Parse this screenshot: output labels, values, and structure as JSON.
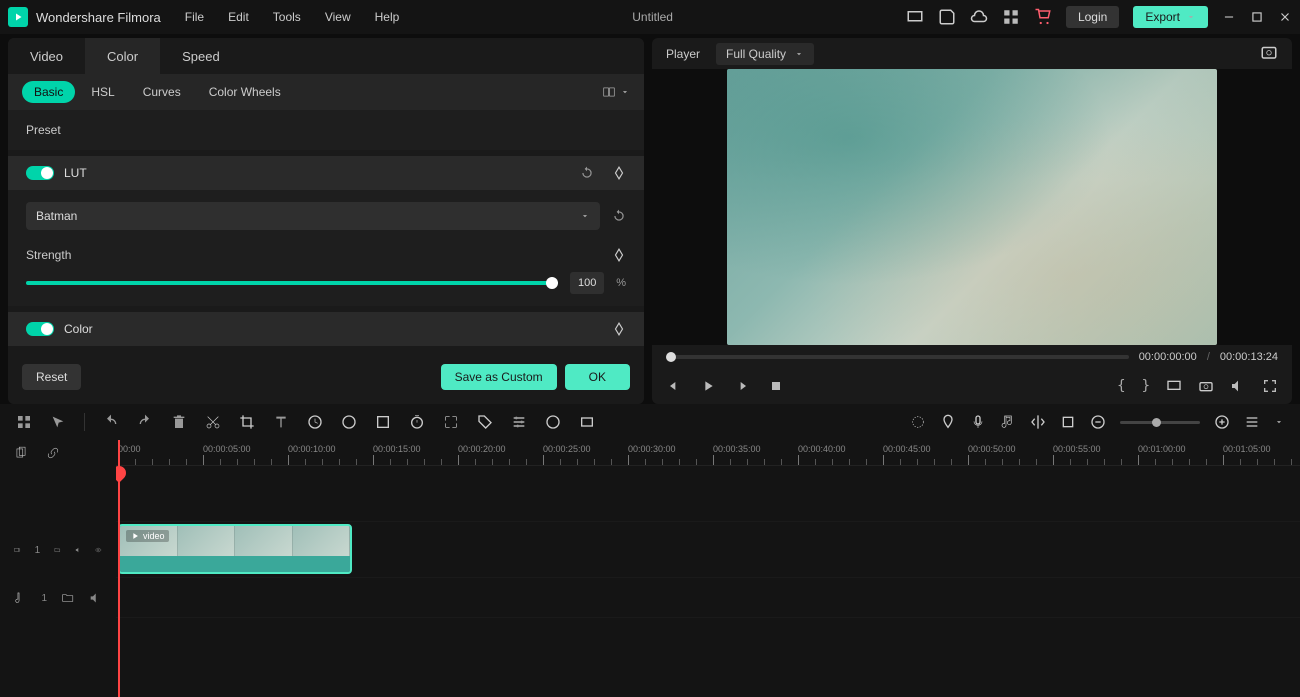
{
  "app": {
    "name": "Wondershare Filmora",
    "title": "Untitled"
  },
  "menu": [
    "File",
    "Edit",
    "Tools",
    "View",
    "Help"
  ],
  "header": {
    "login": "Login",
    "export": "Export"
  },
  "tabs": [
    "Video",
    "Color",
    "Speed"
  ],
  "subtabs": [
    "Basic",
    "HSL",
    "Curves",
    "Color Wheels"
  ],
  "panel": {
    "preset": "Preset",
    "lut": "LUT",
    "lut_value": "Batman",
    "strength": "Strength",
    "strength_val": "100",
    "strength_unit": "%",
    "color": "Color",
    "reset": "Reset",
    "save_custom": "Save as Custom",
    "ok": "OK"
  },
  "player": {
    "label": "Player",
    "quality": "Full Quality",
    "time_current": "00:00:00:00",
    "time_total": "00:00:13:24",
    "sep": "/"
  },
  "timeline": {
    "ticks": [
      "00:00",
      "00:00:05:00",
      "00:00:10:00",
      "00:00:15:00",
      "00:00:20:00",
      "00:00:25:00",
      "00:00:30:00",
      "00:00:35:00",
      "00:00:40:00",
      "00:00:45:00",
      "00:00:50:00",
      "00:00:55:00",
      "00:01:00:00",
      "00:01:05:00"
    ],
    "clip_label": "video",
    "video_track": "1",
    "audio_track": "1"
  }
}
